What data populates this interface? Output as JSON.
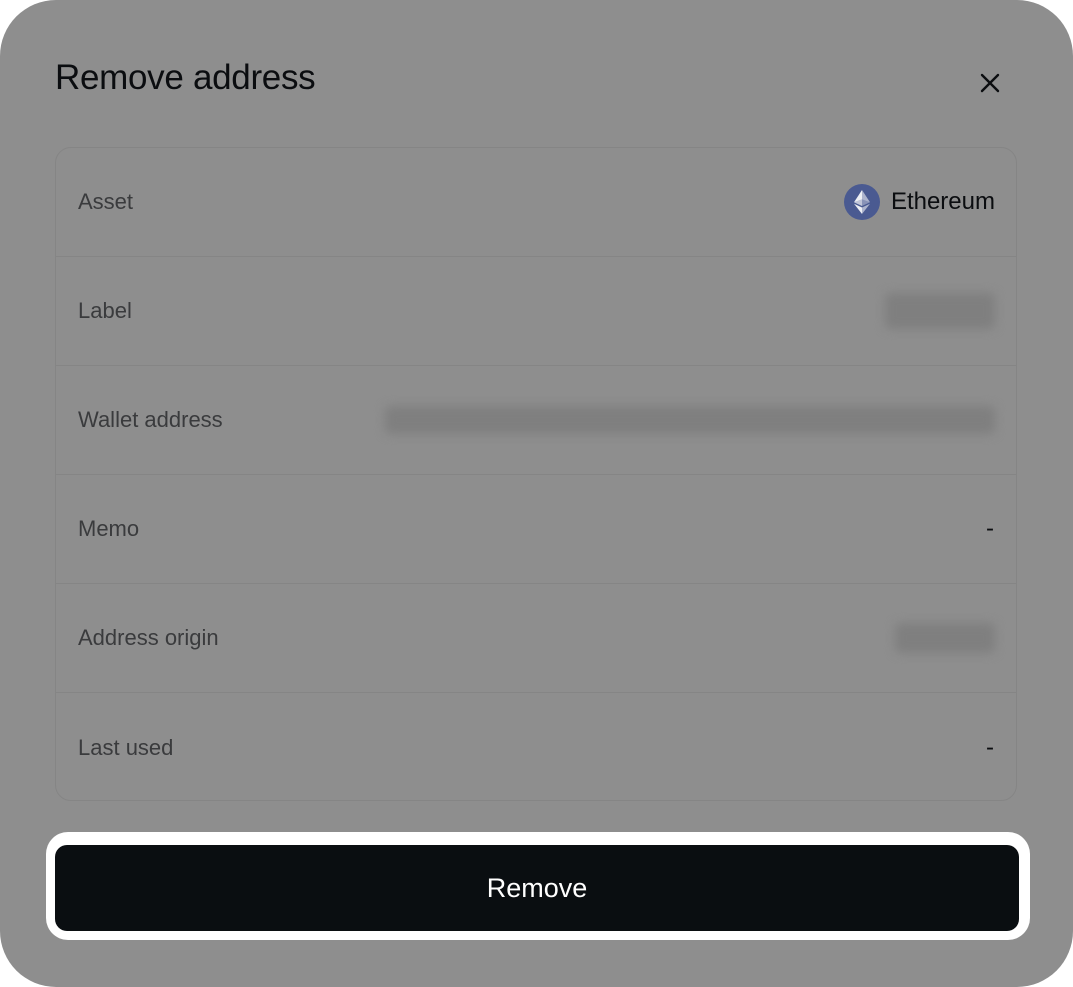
{
  "dialog": {
    "title": "Remove address",
    "close_icon": "close-icon"
  },
  "details": {
    "asset": {
      "label": "Asset",
      "value": "Ethereum",
      "icon": "ethereum-icon",
      "icon_color": "#4a5a91"
    },
    "label": {
      "label": "Label",
      "value": ""
    },
    "wallet_address": {
      "label": "Wallet address",
      "value": ""
    },
    "memo": {
      "label": "Memo",
      "value": "-"
    },
    "address_origin": {
      "label": "Address origin",
      "value": ""
    },
    "last_used": {
      "label": "Last used",
      "value": "-"
    }
  },
  "actions": {
    "remove_label": "Remove"
  },
  "colors": {
    "overlay": "#8e8e8e",
    "button_bg": "#0a0e11",
    "button_text": "#ffffff",
    "focus_ring": "#ffffff"
  }
}
